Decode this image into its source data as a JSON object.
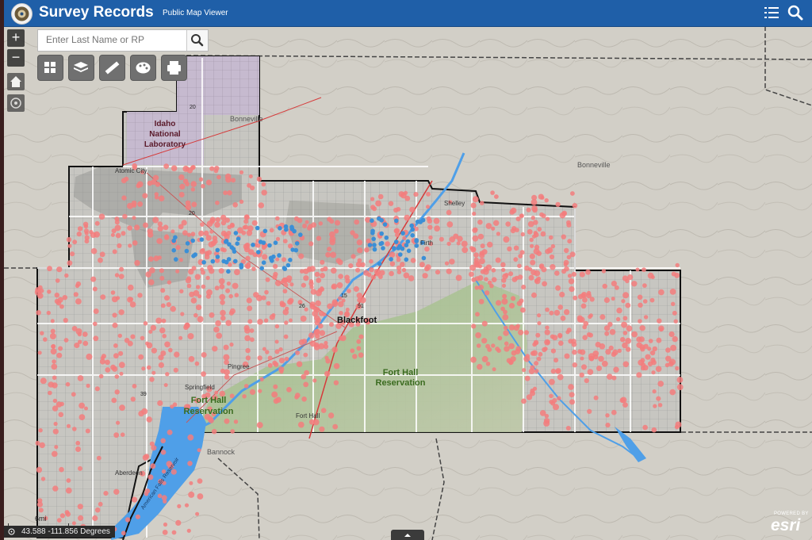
{
  "header": {
    "title": "Survey Records",
    "subtitle": "Public Map Viewer"
  },
  "search": {
    "placeholder": "Enter Last Name or RP"
  },
  "zoom": {
    "in_label": "+",
    "out_label": "−"
  },
  "map_labels": {
    "inl_line1": "Idaho",
    "inl_line2": "National",
    "inl_line3": "Laboratory",
    "bonneville_north": "Bonneville",
    "bonneville_east": "Bonneville",
    "arco": "Atomic City",
    "shelley": "Shelley",
    "firth": "Firth",
    "blackfoot": "Blackfoot",
    "fort_hall_res_1": "Fort Hall",
    "fort_hall_res_2": "Reservation",
    "fort_hall_res_west_1": "Fort Hall",
    "fort_hall_res_west_2": "Reservation",
    "pingree": "Pingree",
    "springfield": "Springfield",
    "fort_hall_town": "Fort Hall",
    "bannock": "Bannock",
    "aberdeen": "Aberdeen",
    "american_falls": "American Falls Reservoir",
    "hwy_20_a": "20",
    "hwy_20_b": "20",
    "hwy_26": "26",
    "hwy_91": "91",
    "hwy_39": "39",
    "i15": "15"
  },
  "scale": {
    "label": "6mi"
  },
  "coordinates": {
    "text": "43.588 -111.856 Degrees"
  },
  "attribution": {
    "powered": "POWERED BY",
    "brand": "esri"
  },
  "colors": {
    "header": "#1f5fa8",
    "survey_point": "#f37c7c",
    "water": "#4f9fe8",
    "reservation": "#8fb67a",
    "inl": "#c4b8cc",
    "well_point": "#3b8fd6"
  },
  "icons": [
    "logo-seal-icon",
    "list-icon",
    "search-icon",
    "home-icon",
    "locate-icon",
    "basemap-gallery-icon",
    "layers-icon",
    "measure-icon",
    "legend-palette-icon",
    "print-icon",
    "coordinates-icon"
  ]
}
